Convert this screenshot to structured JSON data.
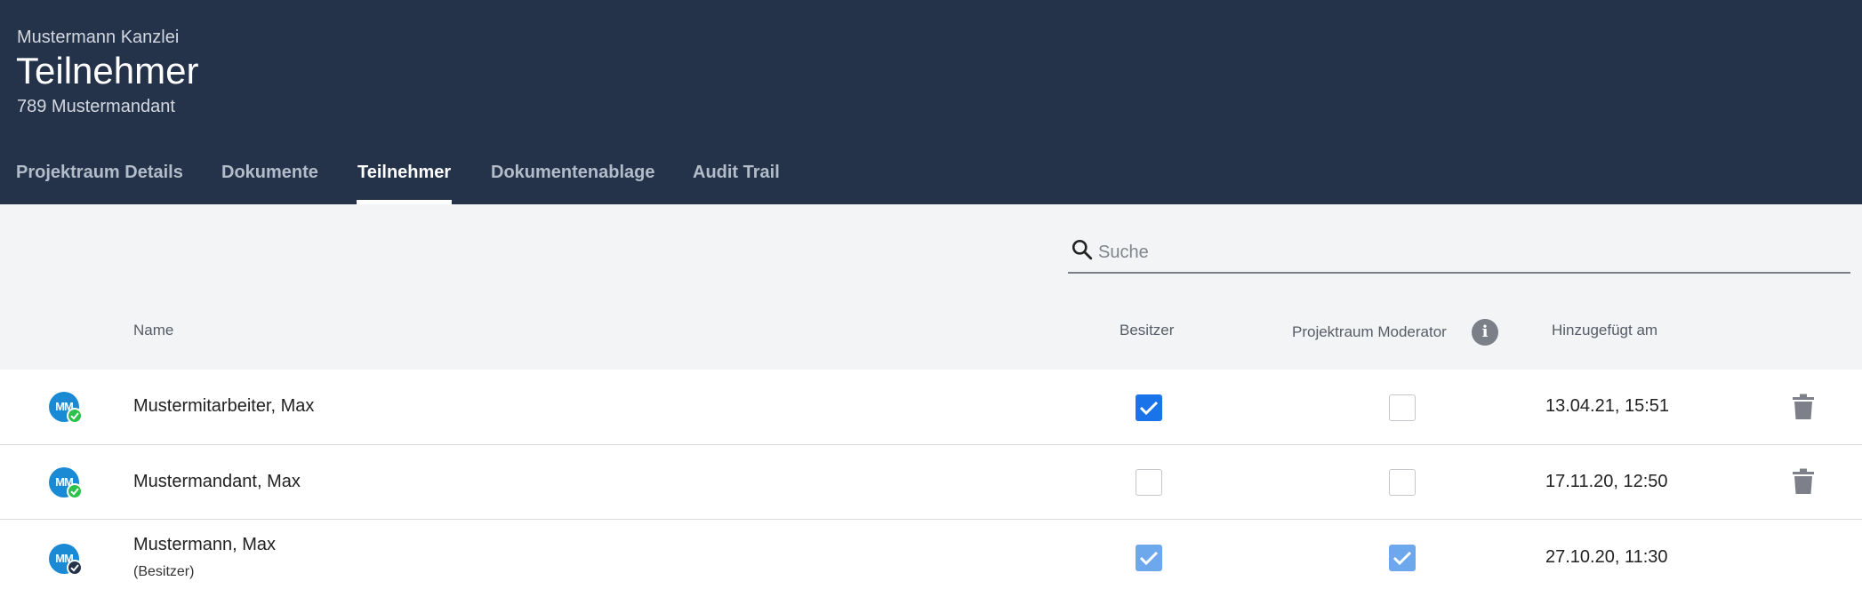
{
  "header": {
    "organization": "Mustermann Kanzlei",
    "title": "Teilnehmer",
    "client": "789 Mustermandant"
  },
  "tabs": [
    {
      "label": "Projektraum Details",
      "active": false
    },
    {
      "label": "Dokumente",
      "active": false
    },
    {
      "label": "Teilnehmer",
      "active": true
    },
    {
      "label": "Dokumentenablage",
      "active": false
    },
    {
      "label": "Audit Trail",
      "active": false
    }
  ],
  "search": {
    "placeholder": "Suche",
    "value": ""
  },
  "columns": {
    "name": "Name",
    "owner": "Besitzer",
    "moderator": "Projektraum Moderator",
    "added": "Hinzugefügt am"
  },
  "icons": {
    "search": "search-icon",
    "info": "info-icon",
    "delete": "trash-icon",
    "status": "check-badge-icon"
  },
  "colors": {
    "header_bg": "#24324a",
    "accent": "#1a73e8",
    "avatar": "#1a8ad4",
    "status_ok": "#2bc14a"
  },
  "participants": [
    {
      "initials": "MM",
      "name": "Mustermitarbeiter, Max",
      "subtitle": "",
      "status": "green",
      "owner": true,
      "owner_disabled": false,
      "moderator": false,
      "moderator_disabled": false,
      "added": "13.04.21, 15:51",
      "deletable": true
    },
    {
      "initials": "MM",
      "name": "Mustermandant, Max",
      "subtitle": "",
      "status": "green",
      "owner": false,
      "owner_disabled": false,
      "moderator": false,
      "moderator_disabled": false,
      "added": "17.11.20, 12:50",
      "deletable": true
    },
    {
      "initials": "MM",
      "name": "Mustermann, Max",
      "subtitle": "(Besitzer)",
      "status": "dark",
      "owner": true,
      "owner_disabled": true,
      "moderator": true,
      "moderator_disabled": true,
      "added": "27.10.20, 11:30",
      "deletable": false
    }
  ]
}
